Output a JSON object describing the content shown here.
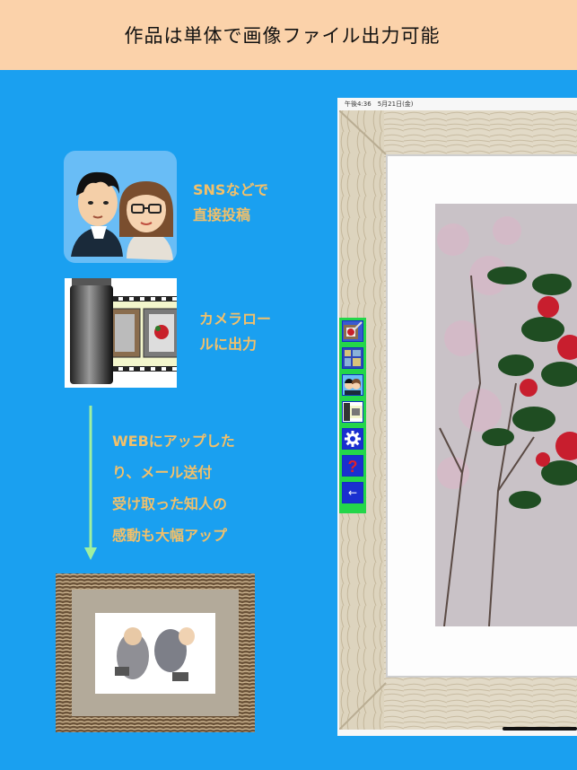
{
  "banner": {
    "title": "作品は単体で画像ファイル出力可能"
  },
  "features": {
    "sns_lines": [
      "SNSなどで",
      "直接投稿"
    ],
    "camera_lines": [
      "カメラロー",
      "ルに出力"
    ],
    "web_lines": [
      "WEBにアップした",
      "り、メール送付",
      "受け取った知人の",
      "感動も大幅アップ"
    ]
  },
  "device": {
    "status": "午後4:36　5月21日(金)",
    "toolbar": [
      {
        "name": "frame-photo-icon"
      },
      {
        "name": "layout-icon"
      },
      {
        "name": "people-icon"
      },
      {
        "name": "film-icon"
      },
      {
        "name": "gear-icon"
      },
      {
        "name": "help-icon",
        "glyph": "?"
      },
      {
        "name": "back-arrow-icon",
        "glyph": "←"
      }
    ]
  },
  "colors": {
    "background": "#1aa0f0",
    "banner": "#fbd2aa",
    "label": "#f2c06a",
    "toolbar": "#24d64a",
    "arrow": "#9ff0a0"
  }
}
